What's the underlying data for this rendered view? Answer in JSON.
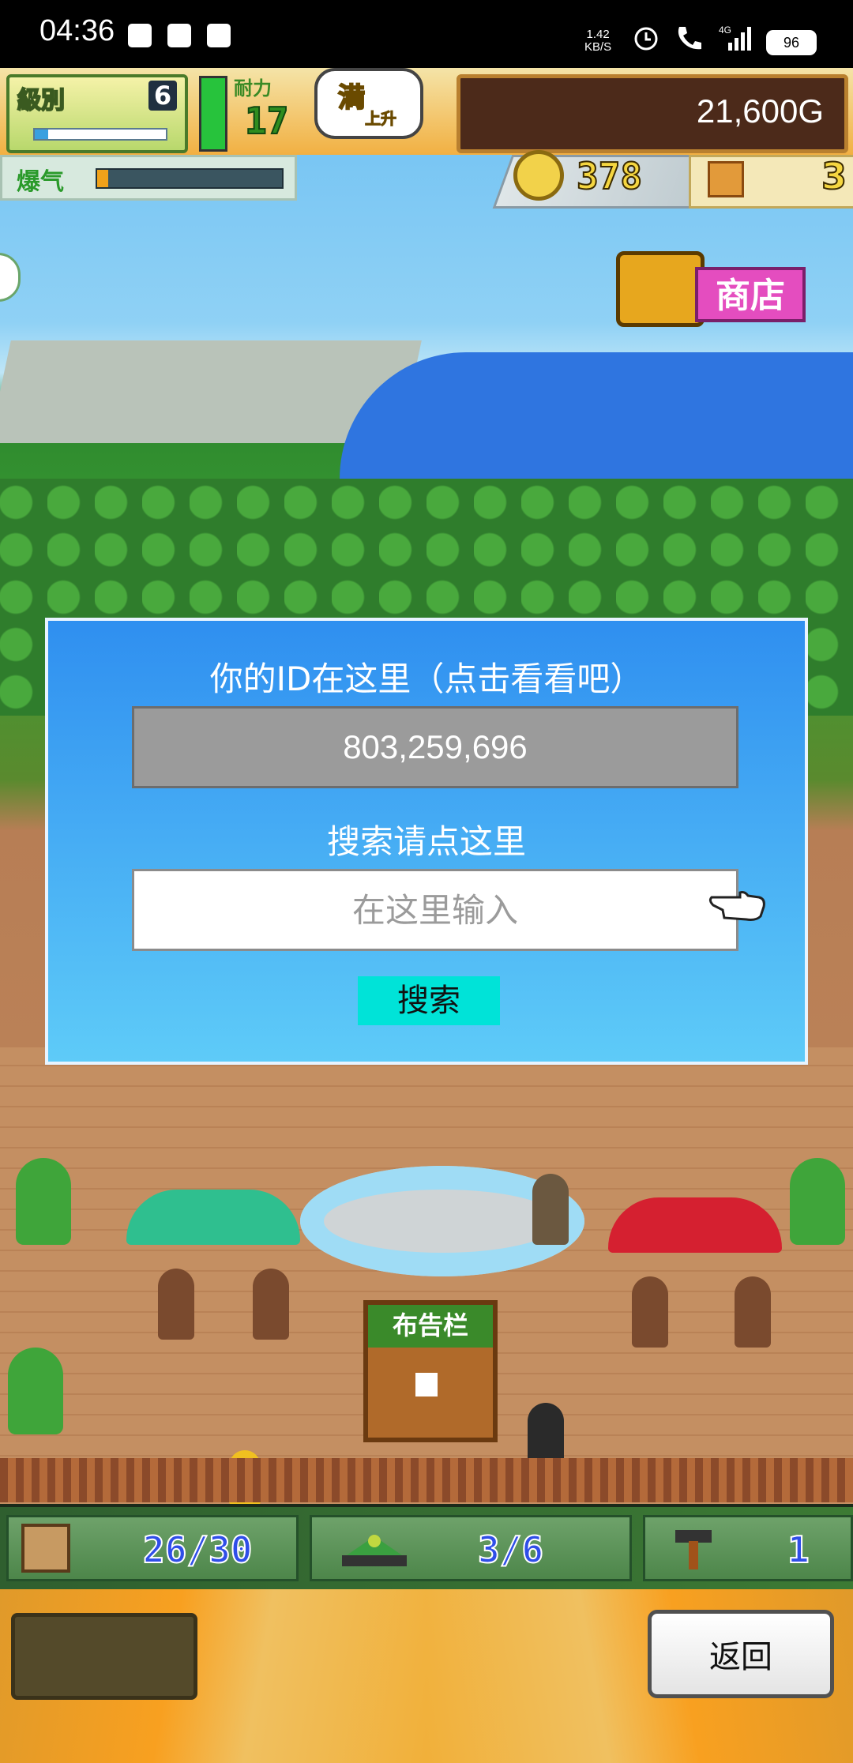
{
  "status_bar": {
    "time": "04:36",
    "net_speed_value": "1.42",
    "net_speed_unit": "KB/S",
    "network_type": "4G",
    "battery": "96"
  },
  "hud": {
    "level_label": "級別",
    "level_value": "6",
    "level_progress": 0.1,
    "stamina_label": "耐力",
    "stamina_value": "17",
    "stamina_level": 1.0,
    "full_label": "満",
    "full_sub": "上升",
    "gold": "21,600G",
    "hype_label": "爆气",
    "hype_level": 0.06,
    "medals": "378",
    "boxes": "3",
    "shop_label": "商店"
  },
  "scene": {
    "bulletin_label": "布告栏"
  },
  "dialog": {
    "id_title": "你的ID在这里（点击看看吧）",
    "id_value": "803,259,696",
    "search_title": "搜索请点这里",
    "search_placeholder": "在这里输入",
    "search_value": "",
    "search_button": "搜索"
  },
  "bottom_hud": {
    "crates": "26/30",
    "planes": "3/6",
    "tools": "1",
    "back_button": "返回"
  },
  "colors": {
    "dialog_top": "#2f8ff0",
    "dialog_bottom": "#5ecbf8",
    "search_button": "#00e3d8",
    "shop_pink": "#e44dbf",
    "gold_box": "#4c2a1a"
  },
  "icons": [
    "envelope-icon",
    "notification-bell-icon",
    "weibo-icon",
    "alarm-icon",
    "phone-icon",
    "signal-icon",
    "battery-icon",
    "medal-icon",
    "box-icon",
    "treasure-chest-icon",
    "hand-pointer-icon",
    "crate-icon",
    "airplane-icon",
    "hammer-icon"
  ]
}
